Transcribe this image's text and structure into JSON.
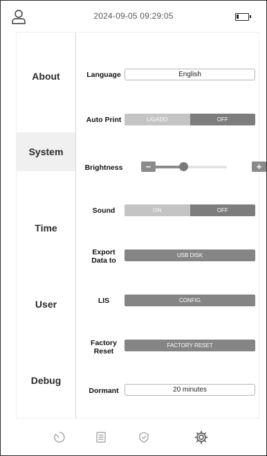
{
  "status_bar": {
    "datetime": "2024-09-05  09:29:05",
    "battery_level": 0.15
  },
  "sidebar": {
    "items": [
      {
        "label": "About",
        "active": false
      },
      {
        "label": "System",
        "active": true
      },
      {
        "label": "Time",
        "active": false
      },
      {
        "label": "User",
        "active": false
      },
      {
        "label": "Debug",
        "active": false
      }
    ]
  },
  "settings": {
    "language": {
      "label": "Language",
      "value": "English"
    },
    "auto_print": {
      "label": "Auto Print",
      "on_label": "LIGADO",
      "off_label": "OFF",
      "selected": "OFF"
    },
    "brightness": {
      "label": "Brightness",
      "minus": "−",
      "plus": "+",
      "level": 0.4
    },
    "sound": {
      "label": "Sound",
      "on_label": "ON",
      "off_label": "OFF",
      "selected": "OFF"
    },
    "export_data": {
      "label": "Export Data to",
      "value": "USB DISK"
    },
    "lis": {
      "label": "LIS",
      "value": "CONFIG"
    },
    "factory_reset": {
      "label": "Factory Reset",
      "value": "FACTORY RESET"
    },
    "dormant": {
      "label": "Dormant",
      "value": "20 minutes"
    }
  },
  "bottom_nav": {
    "items": [
      {
        "icon": "timer-icon"
      },
      {
        "icon": "list-icon"
      },
      {
        "icon": "shield-check-icon"
      },
      {
        "icon": "gear-icon",
        "active": true
      }
    ]
  },
  "colors": {
    "toggle_on": "#c4c4c4",
    "toggle_off": "#7d7d7d",
    "button": "#858585",
    "active_tab_bg": "#f0f0f0"
  }
}
